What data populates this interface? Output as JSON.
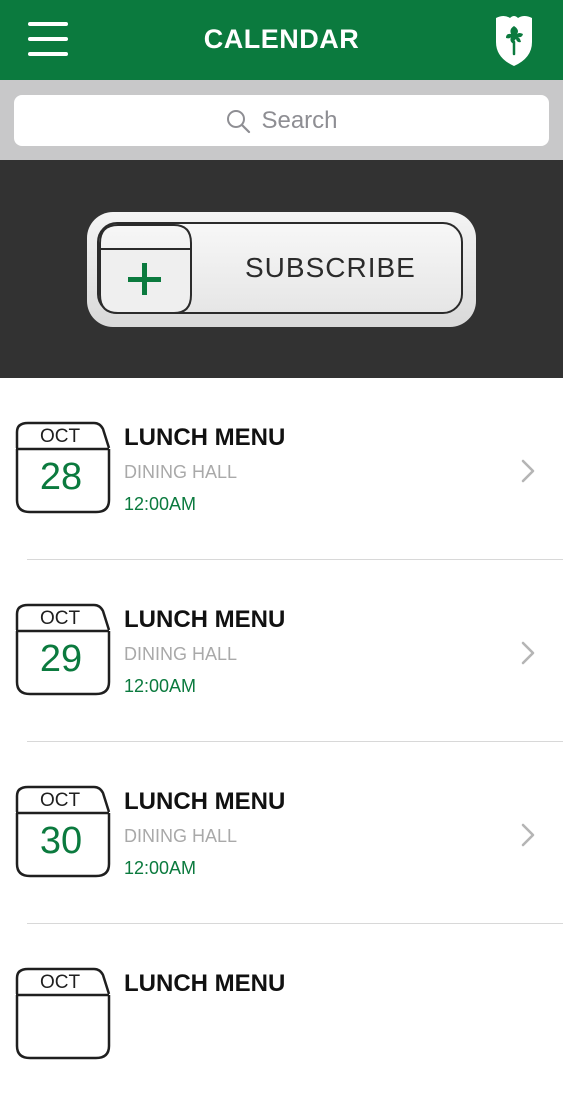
{
  "header": {
    "title": "CALENDAR"
  },
  "search": {
    "placeholder": "Search"
  },
  "subscribe": {
    "label": "SUBSCRIBE"
  },
  "events": [
    {
      "month": "OCT",
      "day": "28",
      "title": "LUNCH MENU",
      "location": "DINING HALL",
      "time": "12:00AM"
    },
    {
      "month": "OCT",
      "day": "29",
      "title": "LUNCH MENU",
      "location": "DINING HALL",
      "time": "12:00AM"
    },
    {
      "month": "OCT",
      "day": "30",
      "title": "LUNCH MENU",
      "location": "DINING HALL",
      "time": "12:00AM"
    },
    {
      "month": "OCT",
      "day": "",
      "title": "LUNCH MENU",
      "location": "",
      "time": ""
    }
  ],
  "colors": {
    "brand_green": "#0b7a3e",
    "search_bg": "#c8c8c9",
    "banner_bg": "#323232",
    "muted_text": "#a9a9a9"
  },
  "icons": {
    "menu": "hamburger-icon",
    "logo": "oak-leaf-shield-logo",
    "search": "search-icon",
    "add": "plus-icon",
    "calendar": "calendar-icon",
    "chevron": "chevron-right-icon"
  }
}
